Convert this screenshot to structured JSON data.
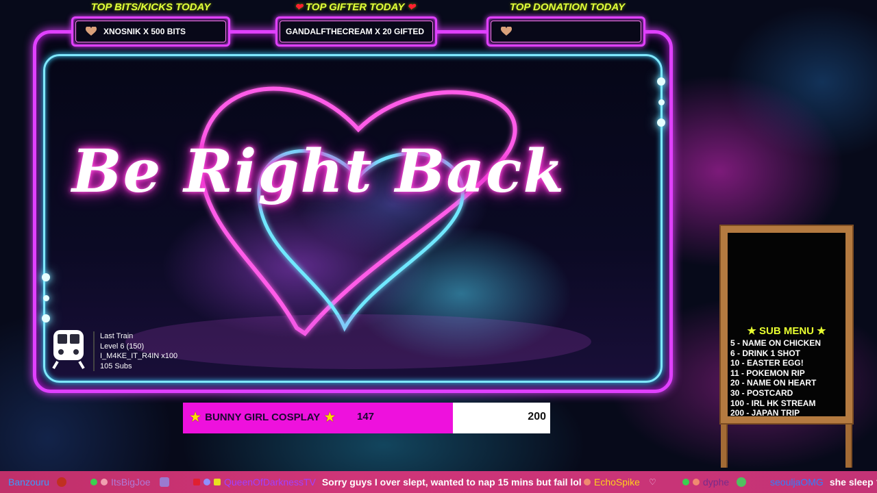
{
  "top_bar": {
    "bits": {
      "title": "TOP BITS/KICKS TODAY",
      "value": "XNOSNIK X 500 BITS",
      "icon": "heart-icon"
    },
    "gifter": {
      "title": "TOP GIFTER TODAY",
      "title_icon": "red-heart-icon",
      "value": "GANDALFTHECREAM X 20 GIFTED",
      "icon": "heart-icon"
    },
    "donation": {
      "title": "TOP DONATION TODAY",
      "value": "",
      "icon": "heart-icon"
    }
  },
  "main": {
    "overlay_text": "Be Right Back",
    "train": {
      "icon": "train-icon",
      "title": "Last Train",
      "level": "Level 6  (150)",
      "user": "I_M4KE_IT_R4IN x100",
      "subs": "105 Subs"
    }
  },
  "goal": {
    "label": "BUNNY GIRL COSPLAY",
    "current": "147",
    "target": "200",
    "progress_fraction": 0.735,
    "fill_color": "#ee11dd"
  },
  "sub_menu": {
    "title": "SUB MENU",
    "items": [
      "5 - NAME ON CHICKEN",
      "6 - DRINK 1 SHOT",
      "10 - EASTER EGG!",
      "11 - POKEMON RIP",
      "20 - NAME ON HEART",
      "30 - POSTCARD",
      "100 - IRL HK STREAM",
      "200 - JAPAN TRIP"
    ]
  },
  "chat": [
    {
      "user": "Banzouru",
      "color": "#3a9bff",
      "message": ""
    },
    {
      "user": "ItsBigJoe",
      "color": "#b07ad8",
      "message": ""
    },
    {
      "user": "QueenOfDarknessTV",
      "color": "#a040ff",
      "message": "Sorry guys I over slept, wanted to nap 15 mins but fail lol"
    },
    {
      "user": "EchoSpike",
      "color": "#ffd21a",
      "message": ""
    },
    {
      "user": "dyphe",
      "color": "#7a2a8a",
      "message": ""
    },
    {
      "user": "seouljaOMG",
      "color": "#3080ff",
      "message": "she sleep ?"
    }
  ],
  "colors": {
    "neon_pink": "#e040ff",
    "neon_cyan": "#7fe8ff",
    "title_yellow": "#dfff3a",
    "ticker_bg": "#cf3578"
  }
}
